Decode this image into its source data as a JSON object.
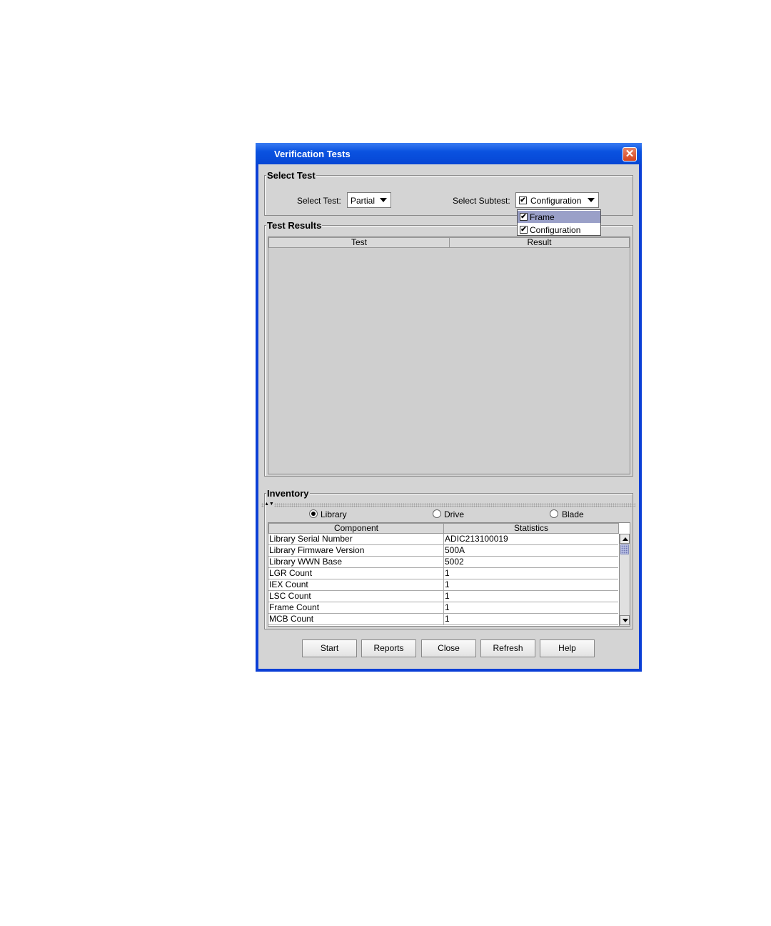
{
  "window": {
    "title": "Verification Tests",
    "close_icon": "close-icon"
  },
  "select_test": {
    "group_title": "Select Test",
    "test_label": "Select Test:",
    "test_value": "Partial",
    "subtest_label": "Select Subtest:",
    "subtest_value": "Configuration",
    "dropdown": [
      {
        "label": "Frame",
        "checked": true,
        "highlighted": true
      },
      {
        "label": "Configuration",
        "checked": true,
        "highlighted": false
      }
    ]
  },
  "test_results": {
    "group_title": "Test Results",
    "columns": [
      "Test",
      "Result"
    ]
  },
  "inventory": {
    "group_title": "Inventory",
    "radios": [
      {
        "label": "Library",
        "selected": true
      },
      {
        "label": "Drive",
        "selected": false
      },
      {
        "label": "Blade",
        "selected": false
      }
    ],
    "columns": [
      "Component",
      "Statistics"
    ],
    "rows": [
      [
        "Library Serial Number",
        "ADIC213100019"
      ],
      [
        "Library Firmware Version",
        "500A"
      ],
      [
        "Library WWN Base",
        "5002"
      ],
      [
        "LGR Count",
        "1"
      ],
      [
        "IEX Count",
        "1"
      ],
      [
        "LSC Count",
        "1"
      ],
      [
        "Frame Count",
        "1"
      ],
      [
        "MCB Count",
        "1"
      ]
    ]
  },
  "buttons": {
    "start": "Start",
    "reports": "Reports",
    "close": "Close",
    "refresh": "Refresh",
    "help": "Help"
  },
  "colors": {
    "titlebar": "#0a52e0",
    "client_bg": "#d4d4d4",
    "selection": "#9aa0c8",
    "close_button": "#d5421d"
  }
}
